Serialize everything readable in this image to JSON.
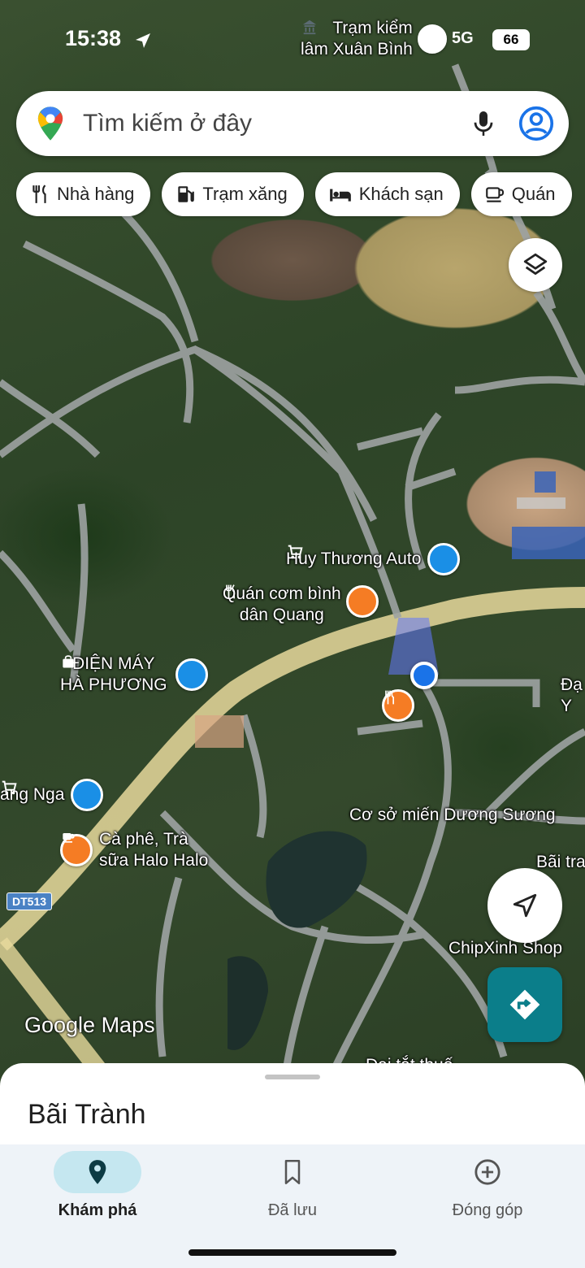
{
  "status_bar": {
    "time": "15:38",
    "network": "5G",
    "battery": "66"
  },
  "search": {
    "placeholder": "Tìm kiếm ở đây"
  },
  "chips": [
    {
      "label": "Nhà hàng",
      "icon": "restaurant-icon"
    },
    {
      "label": "Trạm xăng",
      "icon": "gas-station-icon"
    },
    {
      "label": "Khách sạn",
      "icon": "hotel-icon"
    },
    {
      "label": "Quán",
      "icon": "cafe-icon"
    }
  ],
  "map": {
    "labels": {
      "ranger": "Trạm kiểm\nlâm Xuân Bình",
      "auto": "Huy Thương Auto",
      "com": "Quán cơm bình\ndân Quang",
      "dienmay": "ĐIỆN MÁY\nHÀ PHƯƠNG",
      "nga": "ang Nga",
      "halo": "Cà phê, Trà\nsữa Halo Halo",
      "mien": "Cơ sở miến Dương Sương",
      "baitr": "Bãi tra",
      "chipxinh": "ChipXinh Shop",
      "edge_right": "Đạ\nY",
      "cut_bottom": "Dai tắt thuố"
    },
    "road_shield": "DT513",
    "watermark": "Google Maps"
  },
  "sheet": {
    "title": "Bãi Trành"
  },
  "nav": {
    "explore": "Khám phá",
    "saved": "Đã lưu",
    "contribute": "Đóng góp"
  },
  "colors": {
    "accent": "#0b7e8a",
    "nav_active": "#c5e7f0",
    "poi_food": "#f57c24",
    "poi_shop": "#1a8fe6"
  }
}
